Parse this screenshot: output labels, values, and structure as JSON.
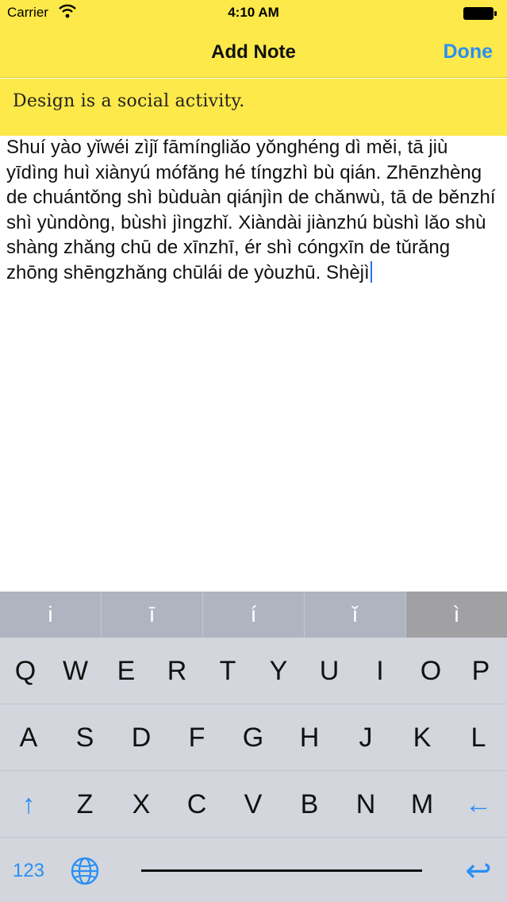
{
  "status_bar": {
    "carrier": "Carrier",
    "time": "4:10 AM"
  },
  "nav": {
    "title": "Add Note",
    "done_label": "Done"
  },
  "note": {
    "title": "Design is a social activity.",
    "body": "Shuí yào yǐwéi zìjǐ fāmíngliǎo yǒnghéng dì měi, tā jiù yīdìng huì xiànyú mófǎng hé tíngzhì bù qián. Zhēnzhèng de chuántǒng shì bùduàn qiánjìn de chǎnwù, tā de běnzhí shì yùndòng, bùshì jìngzhǐ. Xiàndài jiànzhú bùshì lǎo shù shàng zhǎng chū de xīnzhī, ér shì cóngxīn de tǔrǎng zhōng shēngzhǎng chūlái de yòuzhū. Shèjì"
  },
  "suggestions": [
    "i",
    "ī",
    "í",
    "ǐ",
    "ì"
  ],
  "keyboard": {
    "row1": [
      "Q",
      "W",
      "E",
      "R",
      "T",
      "Y",
      "U",
      "I",
      "O",
      "P"
    ],
    "row2": [
      "A",
      "S",
      "D",
      "F",
      "G",
      "H",
      "J",
      "K",
      "L"
    ],
    "row3": [
      "Z",
      "X",
      "C",
      "V",
      "B",
      "N",
      "M"
    ],
    "shift_glyph": "↑",
    "delete_glyph": "←",
    "numbers_label": "123",
    "return_glyph": "↩"
  },
  "colors": {
    "accent": "#2a8ff5",
    "note_yellow": "#fde94a",
    "keyboard_bg": "#d3d6dd"
  }
}
